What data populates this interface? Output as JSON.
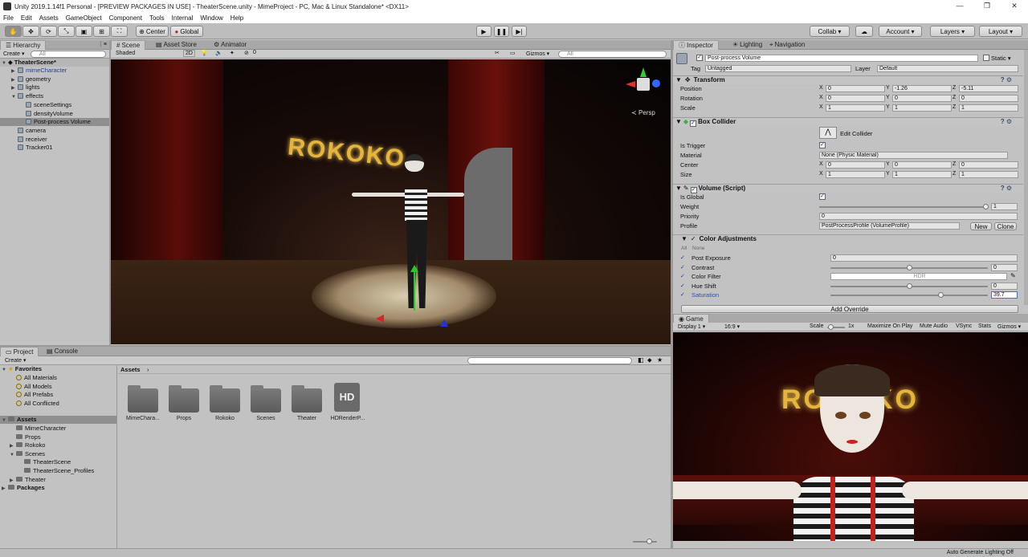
{
  "window": {
    "title": "Unity 2019.1.14f1 Personal - [PREVIEW PACKAGES IN USE] - TheaterScene.unity - MimeProject - PC, Mac & Linux Standalone* <DX11>",
    "minimize": "—",
    "restore": "❐",
    "close": "✕"
  },
  "menu": [
    "File",
    "Edit",
    "Assets",
    "GameObject",
    "Component",
    "Tools",
    "Internal",
    "Window",
    "Help"
  ],
  "toolbar": {
    "center": "Center",
    "global": "Global",
    "collab": "Collab ▾",
    "account": "Account ▾",
    "layers": "Layers ▾",
    "layout": "Layout ▾"
  },
  "hierarchy": {
    "tab": "Hierarchy",
    "create": "Create ▾",
    "search_placeholder": "All",
    "scene": "TheaterScene*",
    "items": [
      {
        "label": "mimeCharacter",
        "indent": 1,
        "arrow": "▶"
      },
      {
        "label": "geometry",
        "indent": 1,
        "arrow": "▶"
      },
      {
        "label": "lights",
        "indent": 1,
        "arrow": "▶"
      },
      {
        "label": "effects",
        "indent": 1,
        "arrow": "▼"
      },
      {
        "label": "sceneSettings",
        "indent": 2,
        "arrow": ""
      },
      {
        "label": "densityVolume",
        "indent": 2,
        "arrow": ""
      },
      {
        "label": "Post-process Volume",
        "indent": 2,
        "arrow": ""
      },
      {
        "label": "camera",
        "indent": 1,
        "arrow": ""
      },
      {
        "label": "receiver",
        "indent": 1,
        "arrow": ""
      },
      {
        "label": "Tracker01",
        "indent": 1,
        "arrow": ""
      }
    ]
  },
  "scene": {
    "tabs": [
      "Scene",
      "Asset Store",
      "Animator"
    ],
    "shading": "Shaded",
    "mode2d": "2D",
    "gizmos": "Gizmos ▾",
    "search_placeholder": "All",
    "persp": "Persp",
    "sign": "ROKOKO",
    "icons": {
      "light": "💡",
      "audio": "🔈",
      "fx": "✦",
      "count": "0"
    }
  },
  "inspector": {
    "tabs": [
      "Inspector",
      "Lighting",
      "Navigation"
    ],
    "object_name": "Post-process Volume",
    "static": "Static ▾",
    "tag_label": "Tag",
    "tag": "Untagged",
    "layer_label": "Layer",
    "layer": "Default",
    "transform": {
      "title": "Transform",
      "rows": [
        {
          "label": "Position",
          "x": "0",
          "y": "-1.26",
          "z": "-5.11"
        },
        {
          "label": "Rotation",
          "x": "0",
          "y": "0",
          "z": "0"
        },
        {
          "label": "Scale",
          "x": "1",
          "y": "1",
          "z": "1"
        }
      ]
    },
    "box_collider": {
      "title": "Box Collider",
      "edit": "Edit Collider",
      "is_trigger": "Is Trigger",
      "material_label": "Material",
      "material": "None (Physic Material)",
      "rows": [
        {
          "label": "Center",
          "x": "0",
          "y": "0",
          "z": "0"
        },
        {
          "label": "Size",
          "x": "1",
          "y": "1",
          "z": "1"
        }
      ]
    },
    "volume": {
      "title": "Volume (Script)",
      "is_global": "Is Global",
      "weight_label": "Weight",
      "weight": "1",
      "priority_label": "Priority",
      "priority": "0",
      "profile_label": "Profile",
      "profile": "PostProcessProfile (VolumeProfile)",
      "new": "New",
      "clone": "Clone"
    },
    "color_adj": {
      "title": "Color Adjustments",
      "all": "All",
      "none": "None",
      "rows": [
        {
          "label": "Post Exposure",
          "value": "0",
          "slider": null
        },
        {
          "label": "Contrast",
          "value": "0",
          "slider": 0.5
        },
        {
          "label": "Color Filter",
          "value": "HDR",
          "slider": null
        },
        {
          "label": "Hue Shift",
          "value": "0",
          "slider": 0.5
        },
        {
          "label": "Saturation",
          "value": "39.7",
          "slider": 0.7
        }
      ]
    },
    "add_override": "Add Override",
    "axes": {
      "x": "X",
      "y": "Y",
      "z": "Z"
    }
  },
  "game": {
    "tab": "Game",
    "display": "Display 1 ▾",
    "aspect": "16:9 ▾",
    "scale_label": "Scale",
    "scale": "1x",
    "maximize": "Maximize On Play",
    "mute": "Mute Audio",
    "vsync": "VSync",
    "stats": "Stats",
    "gizmos": "Gizmos ▾",
    "sign": "ROKOKO"
  },
  "project": {
    "tabs": [
      "Project",
      "Console"
    ],
    "create": "Create ▾",
    "breadcrumb": "Assets",
    "favorites": {
      "label": "Favorites",
      "items": [
        "All Materials",
        "All Models",
        "All Prefabs",
        "All Conflicted"
      ]
    },
    "assets_label": "Assets",
    "assets_tree": [
      {
        "label": "MimeCharacter",
        "indent": 1,
        "arrow": ""
      },
      {
        "label": "Props",
        "indent": 1,
        "arrow": ""
      },
      {
        "label": "Rokoko",
        "indent": 1,
        "arrow": "▶"
      },
      {
        "label": "Scenes",
        "indent": 1,
        "arrow": "▼"
      },
      {
        "label": "TheaterScene",
        "indent": 2,
        "arrow": ""
      },
      {
        "label": "TheaterScene_Profiles",
        "indent": 2,
        "arrow": ""
      },
      {
        "label": "Theater",
        "indent": 1,
        "arrow": "▶"
      }
    ],
    "packages": "Packages",
    "grid": [
      "MimeChara...",
      "Props",
      "Rokoko",
      "Scenes",
      "Theater",
      "HDRenderP..."
    ],
    "hd": "HD"
  },
  "status": "Auto Generate Lighting Off"
}
